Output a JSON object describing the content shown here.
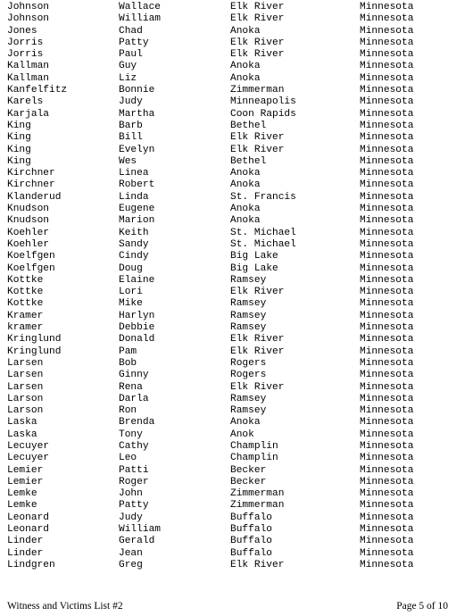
{
  "document": {
    "columns": [
      "last_name",
      "first_name",
      "city",
      "state"
    ],
    "rows": [
      [
        "Johnson",
        "Wallace",
        "Elk River",
        "Minnesota"
      ],
      [
        "Johnson",
        "William",
        "Elk River",
        "Minnesota"
      ],
      [
        "Jones",
        "Chad",
        "Anoka",
        "Minnesota"
      ],
      [
        "Jorris",
        "Patty",
        "Elk River",
        "Minnesota"
      ],
      [
        "Jorris",
        "Paul",
        "Elk River",
        "Minnesota"
      ],
      [
        "Kallman",
        "Guy",
        "Anoka",
        "Minnesota"
      ],
      [
        "Kallman",
        "Liz",
        "Anoka",
        "Minnesota"
      ],
      [
        "Kanfelfitz",
        "Bonnie",
        "Zimmerman",
        "Minnesota"
      ],
      [
        "Karels",
        "Judy",
        "Minneapolis",
        "Minnesota"
      ],
      [
        "Karjala",
        "Martha",
        "Coon Rapids",
        "Minnesota"
      ],
      [
        "King",
        "Barb",
        "Bethel",
        "Minnesota"
      ],
      [
        "King",
        "Bill",
        "Elk River",
        "Minnesota"
      ],
      [
        "King",
        "Evelyn",
        "Elk River",
        "Minnesota"
      ],
      [
        "King",
        "Wes",
        "Bethel",
        "Minnesota"
      ],
      [
        "Kirchner",
        "Linea",
        "Anoka",
        "Minnesota"
      ],
      [
        "Kirchner",
        "Robert",
        "Anoka",
        "Minnesota"
      ],
      [
        "Klanderud",
        "Linda",
        "St. Francis",
        "Minnesota"
      ],
      [
        "Knudson",
        "Eugene",
        "Anoka",
        "Minnesota"
      ],
      [
        "Knudson",
        "Marion",
        "Anoka",
        "Minnesota"
      ],
      [
        "Koehler",
        "Keith",
        "St. Michael",
        "Minnesota"
      ],
      [
        "Koehler",
        "Sandy",
        "St. Michael",
        "Minnesota"
      ],
      [
        "Koelfgen",
        "Cindy",
        "Big Lake",
        "Minnesota"
      ],
      [
        "Koelfgen",
        "Doug",
        "Big Lake",
        "Minnesota"
      ],
      [
        "Kottke",
        "Elaine",
        "Ramsey",
        "Minnesota"
      ],
      [
        "Kottke",
        "Lori",
        "Elk River",
        "Minnesota"
      ],
      [
        "Kottke",
        "Mike",
        "Ramsey",
        "Minnesota"
      ],
      [
        "Kramer",
        "Harlyn",
        "Ramsey",
        "Minnesota"
      ],
      [
        "kramer",
        "Debbie",
        "Ramsey",
        "Minnesota"
      ],
      [
        "Kringlund",
        "Donald",
        "Elk River",
        "Minnesota"
      ],
      [
        "Kringlund",
        "Pam",
        "Elk River",
        "Minnesota"
      ],
      [
        "Larsen",
        "Bob",
        "Rogers",
        "Minnesota"
      ],
      [
        "Larsen",
        "Ginny",
        "Rogers",
        "Minnesota"
      ],
      [
        "Larsen",
        "Rena",
        "Elk River",
        "Minnesota"
      ],
      [
        "Larson",
        "Darla",
        "Ramsey",
        "Minnesota"
      ],
      [
        "Larson",
        "Ron",
        "Ramsey",
        "Minnesota"
      ],
      [
        "Laska",
        "Brenda",
        "Anoka",
        "Minnesota"
      ],
      [
        "Laska",
        "Tony",
        "Anok",
        "Minnesota"
      ],
      [
        "Lecuyer",
        "Cathy",
        "Champlin",
        "Minnesota"
      ],
      [
        "Lecuyer",
        "Leo",
        "Champlin",
        "Minnesota"
      ],
      [
        "Lemier",
        "Patti",
        "Becker",
        "Minnesota"
      ],
      [
        "Lemier",
        "Roger",
        "Becker",
        "Minnesota"
      ],
      [
        "Lemke",
        "John",
        "Zimmerman",
        "Minnesota"
      ],
      [
        "Lemke",
        "Patty",
        "Zimmerman",
        "Minnesota"
      ],
      [
        "Leonard",
        "Judy",
        "Buffalo",
        "Minnesota"
      ],
      [
        "Leonard",
        "William",
        "Buffalo",
        "Minnesota"
      ],
      [
        "Linder",
        "Gerald",
        "Buffalo",
        "Minnesota"
      ],
      [
        "Linder",
        "Jean",
        "Buffalo",
        "Minnesota"
      ],
      [
        "Lindgren",
        "Greg",
        "Elk River",
        "Minnesota"
      ]
    ]
  },
  "footer": {
    "title": "Witness and Victims List #2",
    "page_label": "Page 5 of 10"
  }
}
